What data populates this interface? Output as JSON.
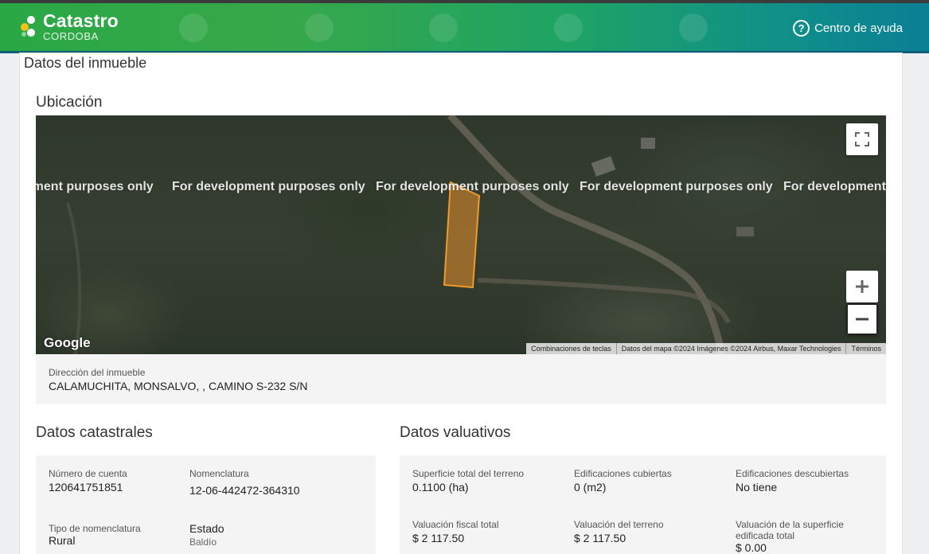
{
  "header": {
    "brand_title": "Catastro",
    "brand_subtitle": "CORDOBA",
    "help_label": "Centro de ayuda",
    "help_icon": "question-circle-icon",
    "colors": {
      "bar_start": "#2aa845",
      "bar_end": "#0b7f94"
    }
  },
  "page": {
    "title": "Datos del inmueble"
  },
  "ubicacion": {
    "heading": "Ubicación",
    "map": {
      "watermark": "For development purposes only",
      "google_logo": "Google",
      "attribution": [
        "Combinaciones de teclas",
        "Datos del mapa ©2024 Imágenes ©2024 Airbus, Maxar Technologies",
        "Términos"
      ],
      "controls": {
        "fullscreen_icon": "fullscreen-icon",
        "zoom_in_icon": "plus-icon",
        "zoom_out_icon": "minus-icon"
      },
      "parcel_color": "#e8902a"
    },
    "address_label": "Dirección del inmueble",
    "address_value": "CALAMUCHITA, MONSALVO, , CAMINO S-232 S/N"
  },
  "catastrales": {
    "heading": "Datos catastrales",
    "numero_cuenta_label": "Número de cuenta",
    "numero_cuenta_value": "120641751851",
    "nomenclatura_label": "Nomenclatura",
    "nomenclatura_value": "12-06-442472-364310",
    "tipo_label": "Tipo de nomenclatura",
    "tipo_value": "Rural",
    "estado_label": "Estado",
    "estado_value": "Baldío"
  },
  "valuativos": {
    "heading": "Datos valuativos",
    "sup_terreno_label": "Superficie total del terreno",
    "sup_terreno_value": "0.1100 (ha)",
    "edif_cubiertas_label": "Edificaciones cubiertas",
    "edif_cubiertas_value": "0 (m2)",
    "edif_descubiertas_label": "Edificaciones descubiertas",
    "edif_descubiertas_value": "No tiene",
    "val_fiscal_label": "Valuación fiscal total",
    "val_fiscal_value": "$ 2 117.50",
    "val_terreno_label": "Valuación del terreno",
    "val_terreno_value": "$ 2 117.50",
    "val_sup_edif_label_1": "Valuación de la superficie",
    "val_sup_edif_label_2": "edificada total",
    "val_sup_edif_value": "$ 0.00"
  }
}
